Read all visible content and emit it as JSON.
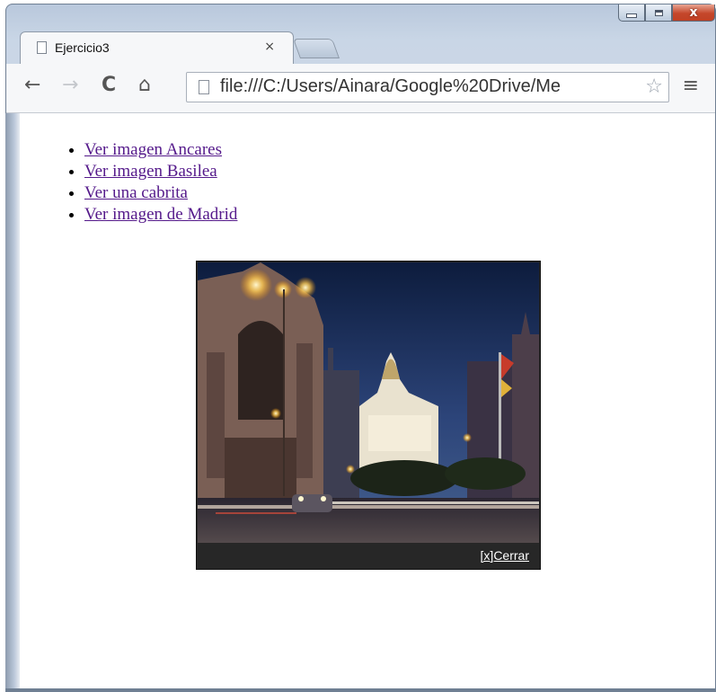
{
  "window": {
    "minimize_icon": "minimize-icon",
    "maximize_icon": "maximize-icon",
    "close_label": "x"
  },
  "tab": {
    "title": "Ejercicio3",
    "close_label": "×",
    "icon": "page-icon"
  },
  "toolbar": {
    "back_label": "←",
    "forward_label": "→",
    "reload_label": "C",
    "home_label": "⌂",
    "url": "file:///C:/Users/Ainara/Google%20Drive/Me",
    "star_label": "☆",
    "menu_label": "≡"
  },
  "links": [
    {
      "label": "Ver imagen Ancares"
    },
    {
      "label": "Ver imagen Basilea"
    },
    {
      "label": "Ver una cabrita"
    },
    {
      "label": "Ver imagen de Madrid"
    }
  ],
  "lightbox": {
    "close_label": "[x]Cerrar"
  },
  "colors": {
    "visited_link": "#551a8b",
    "lightbox_bg": "#272727",
    "close_button": "#c5472b"
  }
}
